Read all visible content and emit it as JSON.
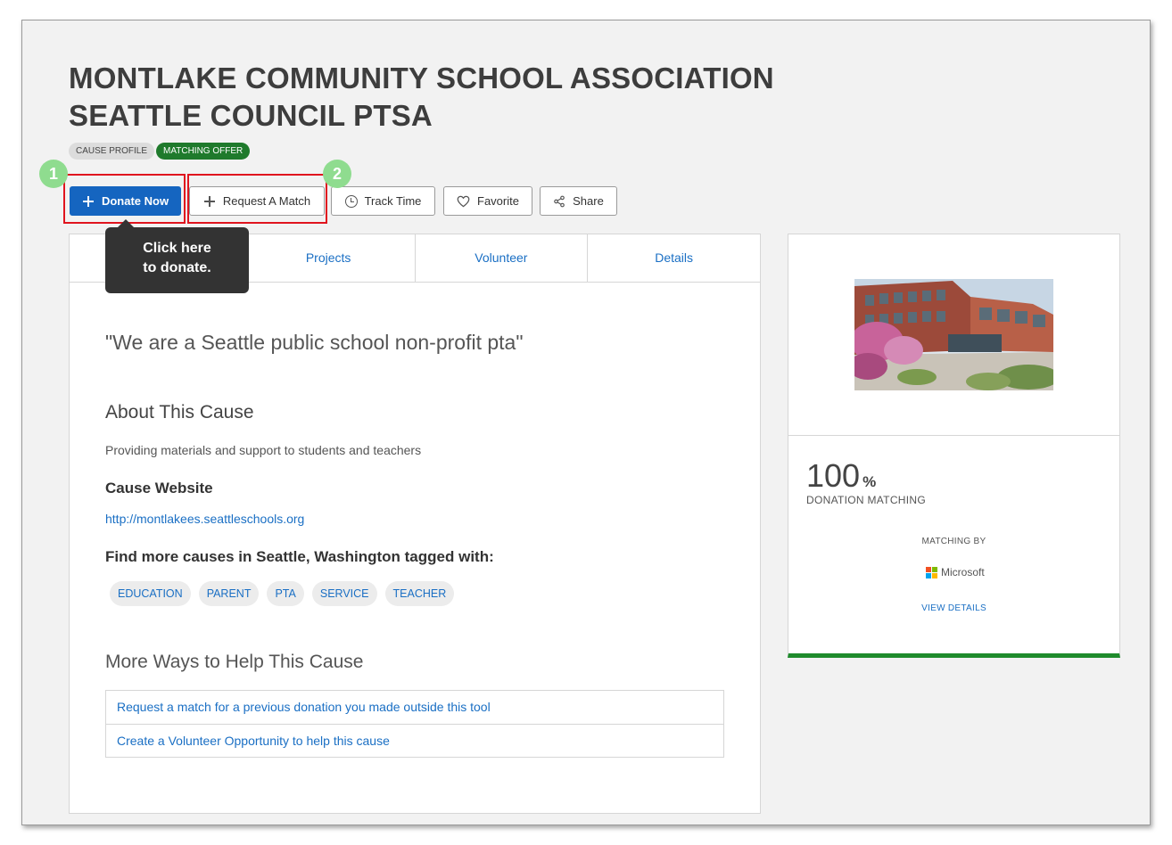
{
  "page": {
    "title_line1": "MONTLAKE COMMUNITY SCHOOL ASSOCIATION",
    "title_line2": "SEATTLE COUNCIL PTSA",
    "badges": {
      "profile": "CAUSE PROFILE",
      "matching": "MATCHING OFFER"
    }
  },
  "actions": {
    "donate": "Donate Now",
    "request_match": "Request A Match",
    "track_time": "Track Time",
    "favorite": "Favorite",
    "share": "Share"
  },
  "annotations": {
    "step1": "1",
    "step2": "2",
    "tooltip_line1": "Click here",
    "tooltip_line2": "to donate."
  },
  "tabs": [
    "Projects",
    "Volunteer",
    "Details"
  ],
  "content": {
    "quote": "\"We are a Seattle public school non-profit pta\"",
    "about_heading": "About This Cause",
    "about_text": "Providing materials and support to students and teachers",
    "website_heading": "Cause Website",
    "website_url": "http://montlakees.seattleschools.org",
    "find_heading": "Find more causes in Seattle, Washington tagged with:",
    "tags": [
      "EDUCATION",
      "PARENT",
      "PTA",
      "SERVICE",
      "TEACHER"
    ],
    "more_heading": "More Ways to Help This Cause",
    "ways": [
      "Request a match for a previous donation you made outside this tool",
      "Create a Volunteer Opportunity to help this cause"
    ]
  },
  "sidebar": {
    "match_value": "100",
    "match_unit": "%",
    "match_label": "DONATION MATCHING",
    "matching_by": "MATCHING BY",
    "sponsor": "Microsoft",
    "view_details": "VIEW DETAILS"
  },
  "colors": {
    "primary": "#1565c0",
    "link": "#1a6fc4",
    "matching_green": "#1f7a2c",
    "highlight_red": "#e0141e",
    "step_green": "#8fdc8f",
    "tooltip_bg": "#333333"
  },
  "icons": {
    "donate": "plus-icon",
    "request_match": "plus-icon",
    "track_time": "clock-icon",
    "favorite": "heart-icon",
    "share": "share-icon",
    "sponsor": "microsoft-logo-icon"
  }
}
